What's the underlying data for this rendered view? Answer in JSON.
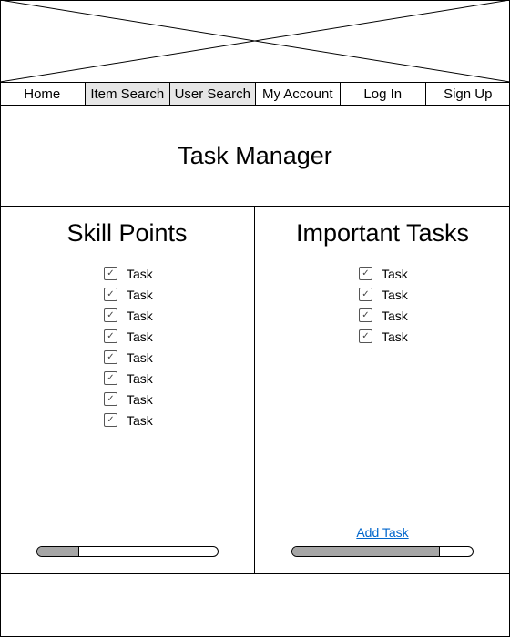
{
  "nav": {
    "items": [
      {
        "label": "Home",
        "shaded": false
      },
      {
        "label": "Item Search",
        "shaded": true
      },
      {
        "label": "User Search",
        "shaded": true
      },
      {
        "label": "My Account",
        "shaded": false
      },
      {
        "label": "Log In",
        "shaded": false
      },
      {
        "label": "Sign Up",
        "shaded": false
      }
    ]
  },
  "header": {
    "title": "Task Manager"
  },
  "skill_panel": {
    "title": "Skill Points",
    "tasks": [
      "Task",
      "Task",
      "Task",
      "Task",
      "Task",
      "Task",
      "Task",
      "Task"
    ],
    "progress": 0.23
  },
  "important_panel": {
    "title": "Important Tasks",
    "tasks": [
      "Task",
      "Task",
      "Task",
      "Task"
    ],
    "add_label": "Add Task",
    "progress": 0.82
  },
  "icons": {
    "checkbox": "checkmark-icon",
    "banner": "image-placeholder-icon"
  },
  "colors": {
    "shaded_nav": "#e6e6e6",
    "progress_fill": "#a6a6a6",
    "link": "#0066cc"
  }
}
